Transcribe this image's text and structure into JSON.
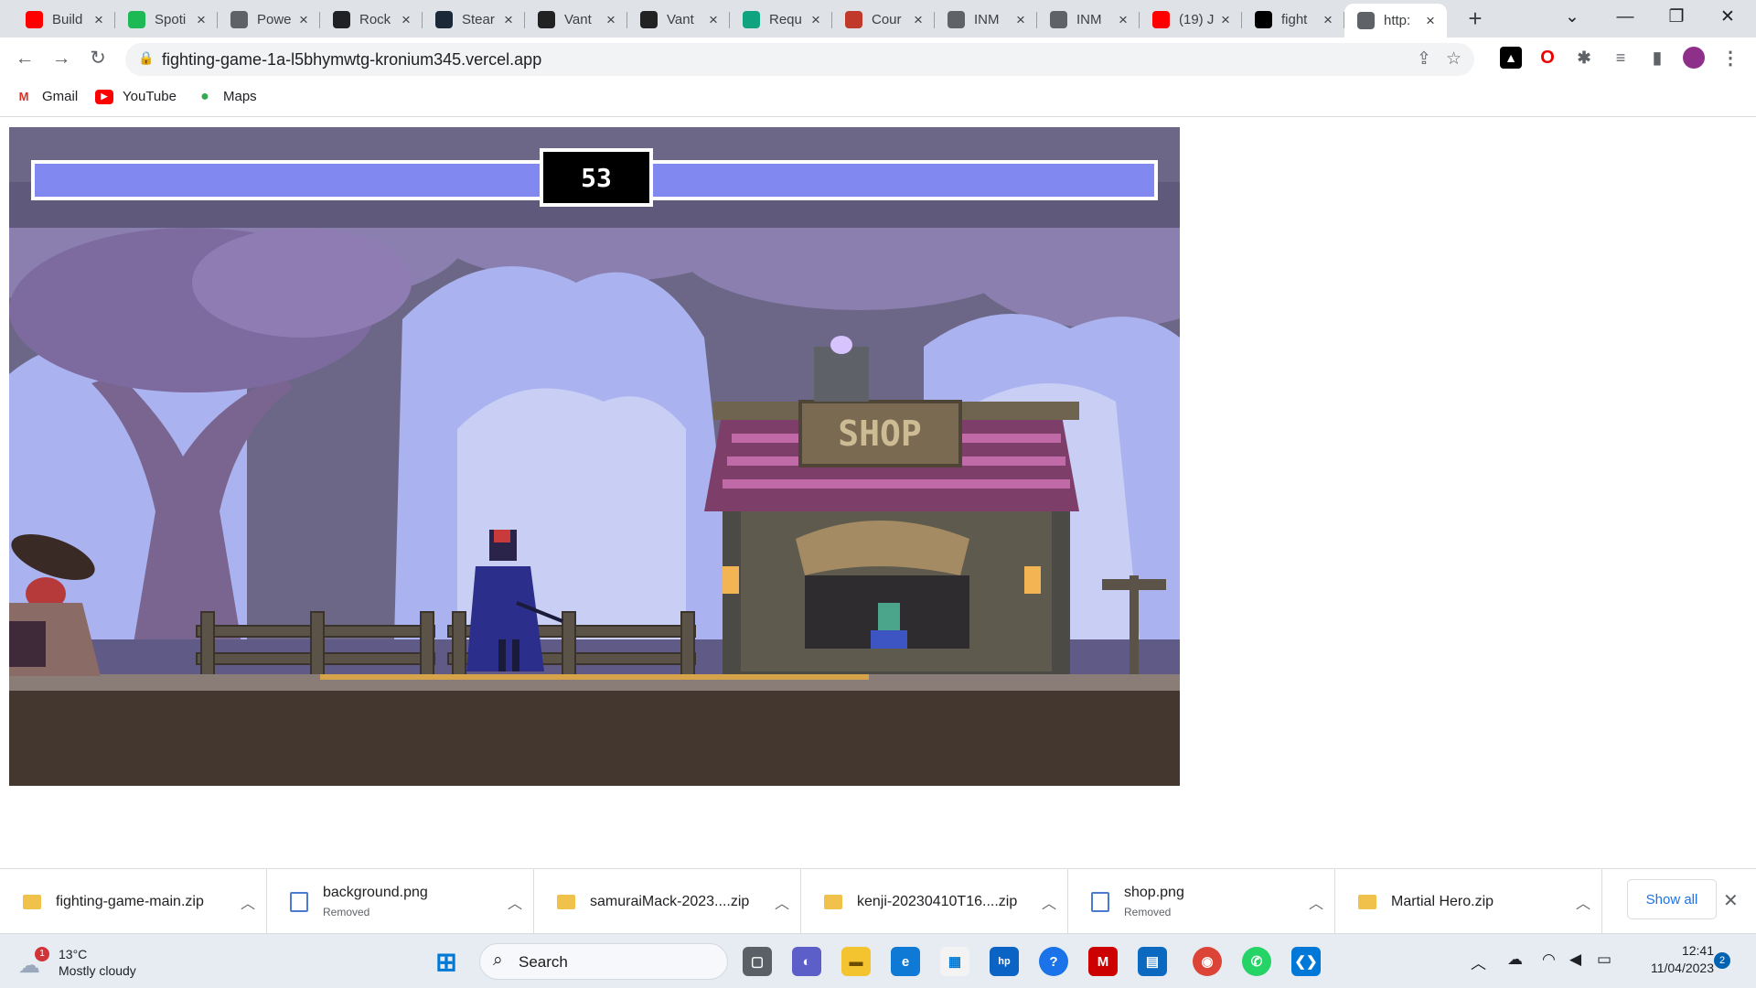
{
  "tabs": [
    {
      "title": "Build",
      "icon": "youtube-icon",
      "color": "#ff0000"
    },
    {
      "title": "Spoti",
      "icon": "spotify-icon",
      "color": "#1db954"
    },
    {
      "title": "Powe",
      "icon": "globe-icon",
      "color": "#5f6368"
    },
    {
      "title": "Rock",
      "icon": "pen-icon",
      "color": "#202124"
    },
    {
      "title": "Stear",
      "icon": "steam-icon",
      "color": "#1b2838"
    },
    {
      "title": "Vant",
      "icon": "v-icon",
      "color": "#222222"
    },
    {
      "title": "Vant",
      "icon": "c-icon",
      "color": "#222222"
    },
    {
      "title": "Requ",
      "icon": "chatgpt-icon",
      "color": "#10a37f"
    },
    {
      "title": "Cour",
      "icon": "course-icon",
      "color": "#c0392b"
    },
    {
      "title": "INM",
      "icon": "globe-icon",
      "color": "#5f6368"
    },
    {
      "title": "INM",
      "icon": "globe-icon",
      "color": "#5f6368"
    },
    {
      "title": "(19) J",
      "icon": "youtube-icon",
      "color": "#ff0000"
    },
    {
      "title": "fight",
      "icon": "vercel-icon",
      "color": "#000000"
    },
    {
      "title": "http:",
      "icon": "globe-icon",
      "color": "#5f6368",
      "active": true
    }
  ],
  "window_controls": {
    "minimize": "—",
    "maximize": "❐",
    "close": "✕",
    "tab_list": "⌄",
    "new_tab": "+"
  },
  "address": {
    "url": "fighting-game-1a-l5bhymwtg-kronium345.vercel.app"
  },
  "bookmarks": [
    {
      "label": "Gmail",
      "icon": "gmail-icon"
    },
    {
      "label": "YouTube",
      "icon": "youtube-icon"
    },
    {
      "label": "Maps",
      "icon": "maps-icon"
    }
  ],
  "game": {
    "timer": "53",
    "player_health": 100,
    "enemy_health": 100,
    "shop_sign": "SHOP",
    "colors": {
      "health": "#8189f1",
      "sky": "#6c6786",
      "ground": "#44372f"
    }
  },
  "downloads": {
    "items": [
      {
        "name": "fighting-game-main.zip",
        "status": "",
        "icon": "zip-folder-icon"
      },
      {
        "name": "background.png",
        "status": "Removed",
        "icon": "image-file-icon"
      },
      {
        "name": "samuraiMack-2023....zip",
        "status": "",
        "icon": "zip-folder-icon"
      },
      {
        "name": "kenji-20230410T16....zip",
        "status": "",
        "icon": "zip-folder-icon"
      },
      {
        "name": "shop.png",
        "status": "Removed",
        "icon": "image-file-icon"
      },
      {
        "name": "Martial Hero.zip",
        "status": "",
        "icon": "zip-folder-icon"
      }
    ],
    "show_all": "Show all"
  },
  "taskbar": {
    "weather_temp": "13°C",
    "weather_desc": "Mostly cloudy",
    "weather_badge": "1",
    "search_label": "Search",
    "time": "12:41",
    "date": "11/04/2023",
    "notification_count": "2"
  }
}
